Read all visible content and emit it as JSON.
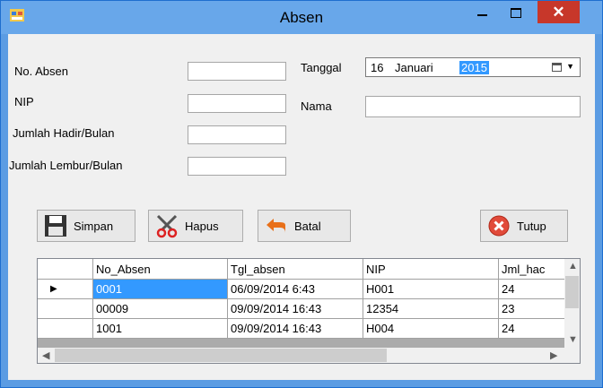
{
  "window": {
    "title": "Absen",
    "close_label": "✕"
  },
  "form": {
    "no_absen_label": "No. Absen",
    "no_absen_value": "",
    "nip_label": "NIP",
    "nip_value": "",
    "jumlah_hadir_label": "Jumlah Hadir/Bulan",
    "jumlah_hadir_value": "",
    "jumlah_lembur_label": "Jumlah Lembur/Bulan",
    "jumlah_lembur_value": "",
    "tanggal_label": "Tanggal",
    "tanggal_day": "16",
    "tanggal_month": "Januari",
    "tanggal_year": "2015",
    "nama_label": "Nama",
    "nama_value": ""
  },
  "buttons": {
    "simpan": "Simpan",
    "hapus": "Hapus",
    "batal": "Batal",
    "tutup": "Tutup"
  },
  "grid": {
    "columns": [
      "No_Absen",
      "Tgl_absen",
      "NIP",
      "Jml_hac"
    ],
    "rows": [
      [
        "0001",
        "06/09/2014 6:43",
        "H001",
        "24"
      ],
      [
        "00009",
        "09/09/2014 16:43",
        "12354",
        "23"
      ],
      [
        "1001",
        "09/09/2014 16:43",
        "H004",
        "24"
      ]
    ],
    "current_row_marker": "▶"
  },
  "colors": {
    "titlebar": "#68a7ea",
    "close": "#c7372a",
    "selection": "#3399ff"
  },
  "icons": [
    "app-icon",
    "minimize-icon",
    "maximize-icon",
    "close-icon",
    "calendar-icon",
    "save-floppy-icon",
    "scissors-icon",
    "undo-arrow-icon",
    "close-circle-icon"
  ]
}
